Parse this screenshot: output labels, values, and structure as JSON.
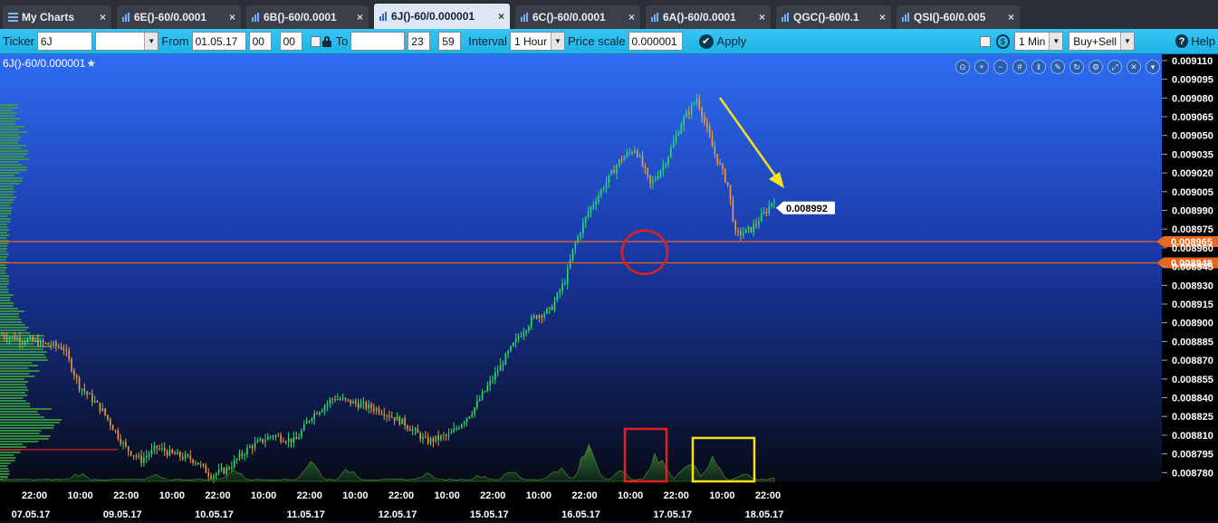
{
  "tabs": [
    {
      "label": "My Charts",
      "type": "menu",
      "close": "×"
    },
    {
      "label": "6E()-60/0.0001",
      "close": "×"
    },
    {
      "label": "6B()-60/0.0001",
      "close": "×"
    },
    {
      "label": "6J()-60/0.000001",
      "close": "×",
      "active": true
    },
    {
      "label": "6C()-60/0.0001",
      "close": "×"
    },
    {
      "label": "6A()-60/0.0001",
      "close": "×"
    },
    {
      "label": "QGC()-60/0.1",
      "close": "×"
    },
    {
      "label": "QSI()-60/0.005",
      "close": "×"
    }
  ],
  "toolbar": {
    "ticker_label": "Ticker",
    "ticker_value": "6J",
    "from_label": "From",
    "from_date": "01.05.17",
    "from_hour": "00",
    "from_min": "00",
    "to_label": "To",
    "to_date": "",
    "to_hour": "23",
    "to_min": "59",
    "interval_label": "Interval",
    "interval_value": "1 Hour",
    "price_scale_label": "Price scale",
    "price_scale_value": "0.000001",
    "apply_label": "Apply",
    "timeframe_value": "1 Min",
    "side_value": "Buy+Sell",
    "help_label": "Help"
  },
  "chart": {
    "title": "6J()-60/0.000001",
    "last_price_label": "0.008992",
    "level1_label": "0.008965",
    "level2_label": "0.008948",
    "colors": {
      "bg_top": "#2f6cf2",
      "bg_bottom": "#070b18",
      "up": "#27e06a",
      "down": "#f59a3a",
      "profile": "#3c9f3c",
      "level": "#e8661e",
      "arrow": "#f4e11a",
      "circle": "#e02020",
      "box_red": "#e02020",
      "box_yellow": "#f4e11a"
    }
  },
  "chart_data": {
    "type": "candlestick",
    "title": "",
    "price_axis": [
      "0.009110",
      "0.009095",
      "0.009080",
      "0.009065",
      "0.009050",
      "0.009035",
      "0.009020",
      "0.009005",
      "0.008990",
      "0.008975",
      "0.008960",
      "0.008945",
      "0.008930",
      "0.008915",
      "0.008900",
      "0.008885",
      "0.008870",
      "0.008855",
      "0.008840",
      "0.008825",
      "0.008810",
      "0.008795",
      "0.008780"
    ],
    "ylim": [
      0.008773,
      0.009115
    ],
    "time_axis": [
      {
        "time": "22:00",
        "date": "07.05.17"
      },
      {
        "time": "10:00",
        "date": ""
      },
      {
        "time": "22:00",
        "date": "09.05.17"
      },
      {
        "time": "10:00",
        "date": ""
      },
      {
        "time": "22:00",
        "date": "10.05.17"
      },
      {
        "time": "10:00",
        "date": ""
      },
      {
        "time": "22:00",
        "date": "11.05.17"
      },
      {
        "time": "10:00",
        "date": ""
      },
      {
        "time": "22:00",
        "date": "12.05.17"
      },
      {
        "time": "10:00",
        "date": ""
      },
      {
        "time": "22:00",
        "date": "15.05.17"
      },
      {
        "time": "10:00",
        "date": ""
      },
      {
        "time": "22:00",
        "date": "16.05.17"
      },
      {
        "time": "10:00",
        "date": ""
      },
      {
        "time": "22:00",
        "date": "17.05.17"
      },
      {
        "time": "10:00",
        "date": ""
      },
      {
        "time": "22:00",
        "date": "18.05.17"
      }
    ],
    "approx_close_path": [
      [
        0,
        0.00889
      ],
      [
        4,
        0.008885
      ],
      [
        8,
        0.00888
      ],
      [
        10,
        0.00885
      ],
      [
        13,
        0.00883
      ],
      [
        16,
        0.0088
      ],
      [
        18,
        0.00879
      ],
      [
        20,
        0.0088
      ],
      [
        22,
        0.008795
      ],
      [
        25,
        0.00879
      ],
      [
        27,
        0.008778
      ],
      [
        29,
        0.008782
      ],
      [
        32,
        0.0088
      ],
      [
        35,
        0.00881
      ],
      [
        38,
        0.008805
      ],
      [
        40,
        0.008825
      ],
      [
        43,
        0.00884
      ],
      [
        46,
        0.008835
      ],
      [
        49,
        0.00883
      ],
      [
        52,
        0.00882
      ],
      [
        55,
        0.008805
      ],
      [
        58,
        0.00881
      ],
      [
        61,
        0.00883
      ],
      [
        63,
        0.00885
      ],
      [
        65,
        0.00887
      ],
      [
        67,
        0.00889
      ],
      [
        69,
        0.008905
      ],
      [
        71,
        0.00891
      ],
      [
        73,
        0.008935
      ],
      [
        74,
        0.00896
      ],
      [
        76,
        0.00899
      ],
      [
        78,
        0.00901
      ],
      [
        80,
        0.00903
      ],
      [
        82,
        0.00904
      ],
      [
        84,
        0.00901
      ],
      [
        86,
        0.00903
      ],
      [
        88,
        0.00906
      ],
      [
        90,
        0.00908
      ],
      [
        92,
        0.00904
      ],
      [
        94,
        0.00901
      ],
      [
        95,
        0.00897
      ],
      [
        97,
        0.008975
      ],
      [
        99,
        0.00899
      ],
      [
        100,
        0.009
      ]
    ],
    "levels": [
      0.008965,
      0.008948
    ],
    "last_price": 0.008992,
    "volume_peaks": [
      [
        0,
        0.1
      ],
      [
        10,
        0.2
      ],
      [
        20,
        0.15
      ],
      [
        30,
        0.3
      ],
      [
        40,
        0.5
      ],
      [
        45,
        0.3
      ],
      [
        55,
        0.2
      ],
      [
        62,
        0.15
      ],
      [
        66,
        0.25
      ],
      [
        72,
        0.35
      ],
      [
        76,
        0.9
      ],
      [
        80,
        0.25
      ],
      [
        85,
        0.7
      ],
      [
        89,
        0.6
      ],
      [
        92,
        0.55
      ],
      [
        96,
        0.2
      ],
      [
        100,
        0.1
      ]
    ],
    "annotations": [
      "red-circle-breakout",
      "yellow-arrow-down",
      "red-box-volume-spike",
      "yellow-box-volume-cluster"
    ]
  }
}
